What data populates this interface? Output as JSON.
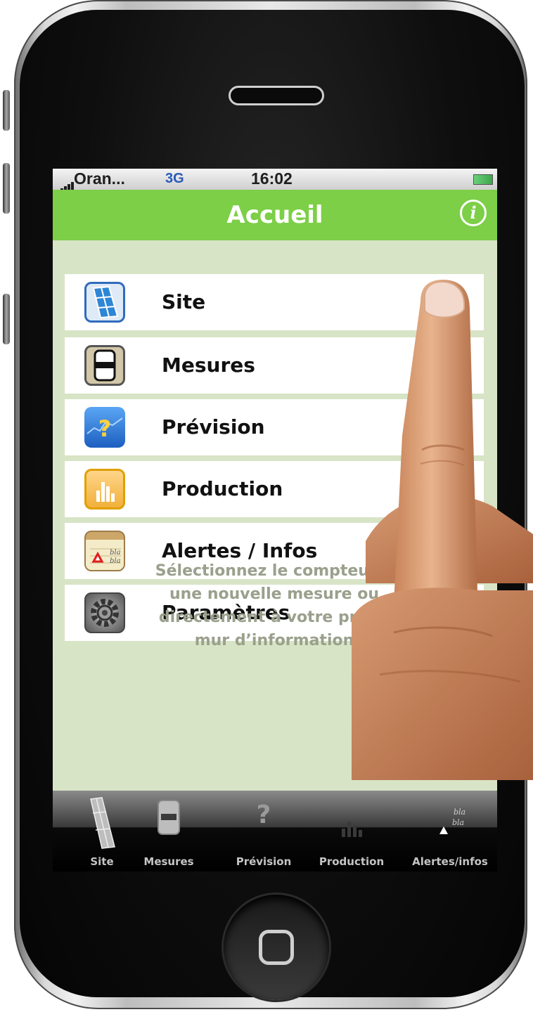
{
  "status_bar": {
    "carrier": "Oran...",
    "network": "3G",
    "time": "16:02"
  },
  "nav": {
    "title": "Accueil",
    "info_icon": "info-icon",
    "info_glyph": "i"
  },
  "menu": {
    "items": [
      {
        "label": "Site",
        "icon": "solar-panel-icon"
      },
      {
        "label": "Mesures",
        "icon": "meter-icon"
      },
      {
        "label": "Prévision",
        "icon": "forecast-icon"
      },
      {
        "label": "Production",
        "icon": "bar-chart-icon"
      },
      {
        "label": "Alertes / Infos",
        "icon": "notepad-alert-icon",
        "icon_text": [
          "bla",
          "bla"
        ]
      },
      {
        "label": "Paramètres",
        "icon": "gear-icon"
      }
    ]
  },
  "hint": {
    "lines": [
      "Sélectionnez le compteur p",
      "une nouvelle mesure ou",
      "directement à votre produ",
      "mur d’information"
    ]
  },
  "tabbar": {
    "tabs": [
      {
        "label": "Site",
        "icon": "solar-panel-icon"
      },
      {
        "label": "Mesures",
        "icon": "meter-icon"
      },
      {
        "label": "Prévision",
        "icon": "question-icon",
        "glyph": "?"
      },
      {
        "label": "Production",
        "icon": "bar-chart-icon"
      },
      {
        "label": "Alertes/infos",
        "icon": "notepad-alert-icon",
        "icon_text": [
          "bla",
          "bla"
        ]
      }
    ]
  },
  "colors": {
    "nav_green": "#7ccf46",
    "screen_bg": "#d8e4c6",
    "hint_text": "#9aa08c"
  }
}
